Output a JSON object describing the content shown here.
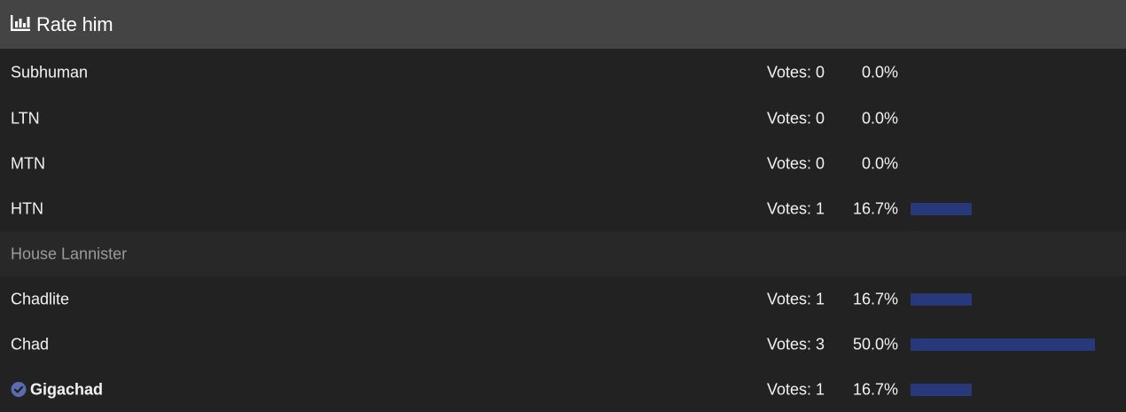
{
  "poll": {
    "title": "Rate him",
    "icon": "bar-chart-icon",
    "bar_color": "#27397a"
  },
  "options": [
    {
      "label": "Subhuman",
      "votes_text": "Votes: 0",
      "percent_text": "0.0%",
      "percent": 0.0
    },
    {
      "label": "LTN",
      "votes_text": "Votes: 0",
      "percent_text": "0.0%",
      "percent": 0.0
    },
    {
      "label": "MTN",
      "votes_text": "Votes: 0",
      "percent_text": "0.0%",
      "percent": 0.0
    },
    {
      "label": "HTN",
      "votes_text": "Votes: 1",
      "percent_text": "16.7%",
      "percent": 16.7
    },
    {
      "label": "House Lannister",
      "votes_text": "",
      "percent_text": "",
      "percent": 0.0
    },
    {
      "label": "Chadlite",
      "votes_text": "Votes: 1",
      "percent_text": "16.7%",
      "percent": 16.7
    },
    {
      "label": "Chad",
      "votes_text": "Votes: 3",
      "percent_text": "50.0%",
      "percent": 50.0
    },
    {
      "label": "Gigachad",
      "votes_text": "Votes: 1",
      "percent_text": "16.7%",
      "percent": 16.7,
      "icon": "check-circle-icon",
      "selected": true
    }
  ]
}
